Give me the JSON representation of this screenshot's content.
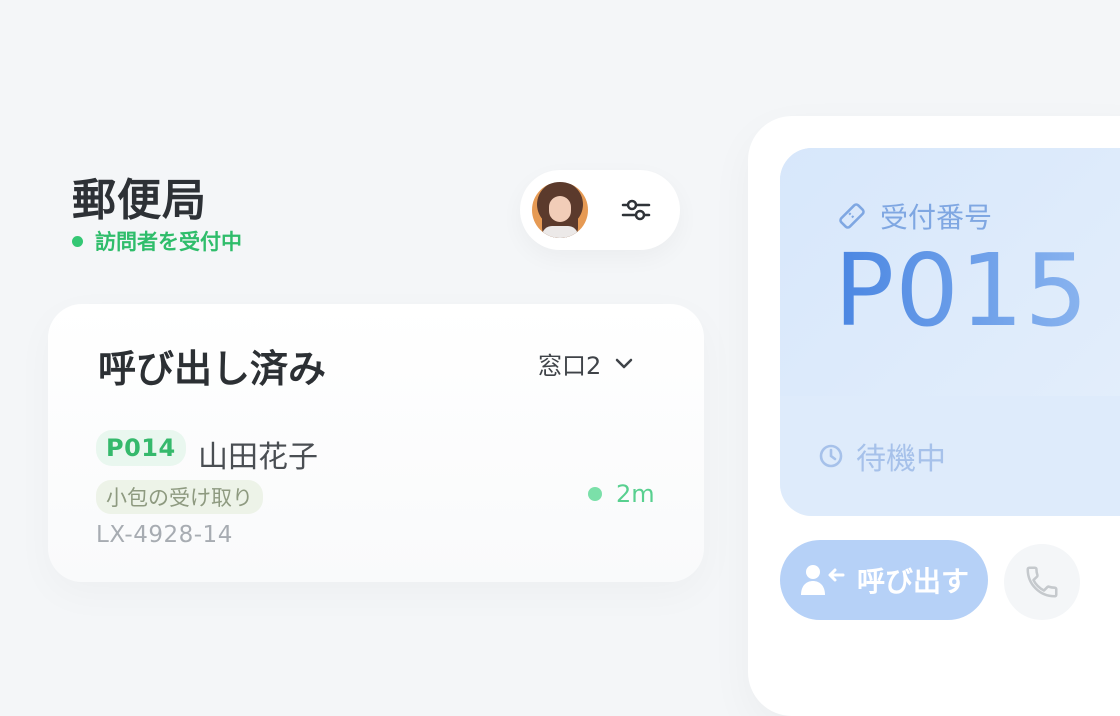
{
  "header": {
    "title": "郵便局",
    "status": "訪問者を受付中"
  },
  "card": {
    "title": "呼び出し済み",
    "counter_label": "窓口2",
    "row": {
      "ticket": "P014",
      "name": "山田花子",
      "tag": "小包の受け取り",
      "code": "LX-4928-14",
      "time": "2m"
    }
  },
  "panel": {
    "ticket_label": "受付番号",
    "ticket_number": "P015",
    "waiting_label": "待機中",
    "call_button_label": "呼び出す"
  },
  "colors": {
    "accent_green": "#34c774",
    "accent_blue": "#4a86e2",
    "call_button": "#b6d1f7"
  },
  "icons": [
    "sliders-icon",
    "chevron-down-icon",
    "ticket-icon",
    "clock-icon",
    "user-call-icon",
    "phone-icon"
  ]
}
